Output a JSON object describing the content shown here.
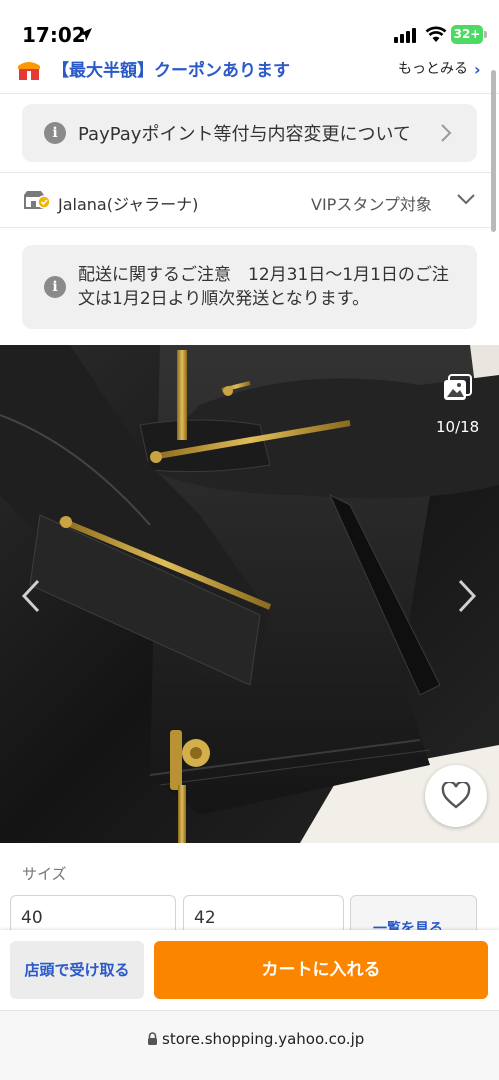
{
  "status_bar": {
    "time": "17:02",
    "battery": "32+"
  },
  "coupon": {
    "text": "【最大半額】クーポンあります",
    "more_label": "もっとみる",
    "more_arrow": "›"
  },
  "notice_paypay": {
    "text": "PayPayポイント等付与内容変更について",
    "icon": "info-icon"
  },
  "store": {
    "name": "Jalana(ジャラーナ)",
    "vip_label": "VIPスタンプ対象"
  },
  "notice_shipping": {
    "text": "配送に関するご注意　12月31日〜1月1日のご注文は1月2日より順次発送となります。",
    "icon": "info-icon"
  },
  "product_image": {
    "counter": "10/18"
  },
  "size": {
    "label": "サイズ",
    "options": [
      "40",
      "42"
    ],
    "more_label": "一覧を見る"
  },
  "actions": {
    "pickup_label": "店頭で受け取る",
    "cart_label": "カートに入れる"
  },
  "url": "store.shopping.yahoo.co.jp",
  "colors": {
    "accent_blue": "#2a59c9",
    "cart_orange": "#fc8500",
    "battery_green": "#4cd964"
  }
}
